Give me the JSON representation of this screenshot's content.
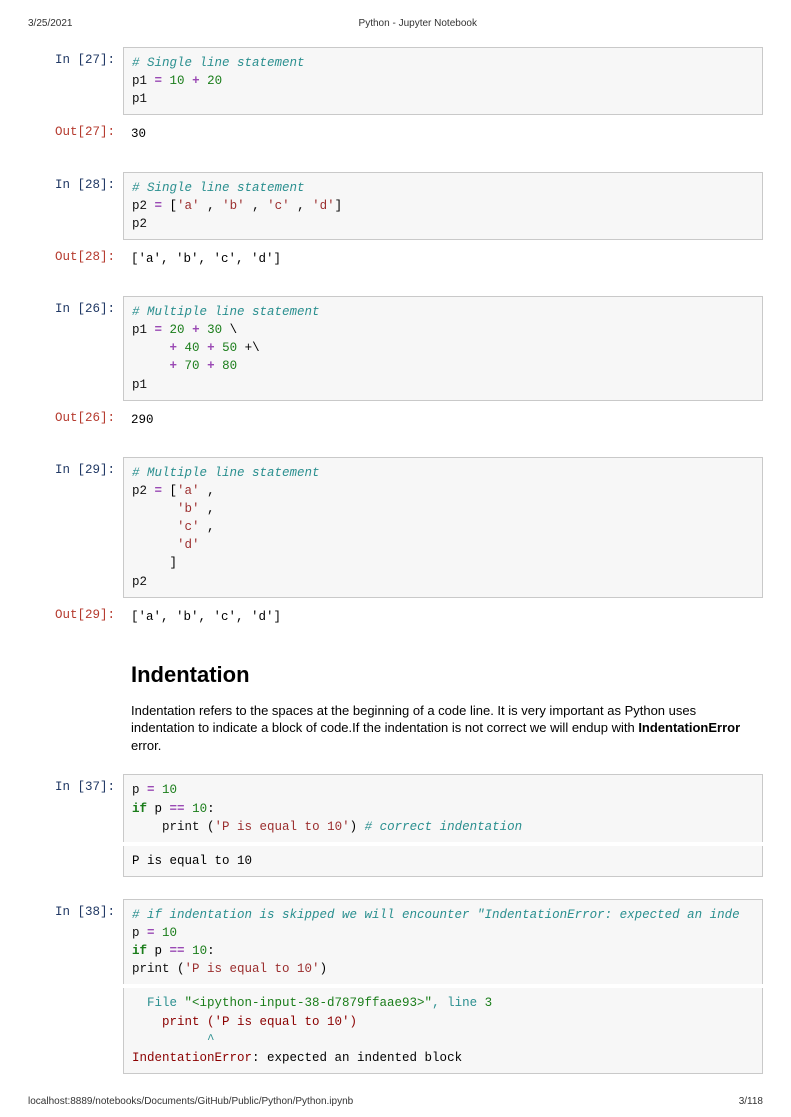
{
  "header": {
    "date": "3/25/2021",
    "title": "Python - Jupyter Notebook"
  },
  "footer": {
    "path": "localhost:8889/notebooks/Documents/GitHub/Public/Python/Python.ipynb",
    "page": "3/118"
  },
  "prompts": {
    "in27": "In [27]:",
    "out27": "Out[27]:",
    "in28": "In [28]:",
    "out28": "Out[28]:",
    "in26": "In [26]:",
    "out26": "Out[26]:",
    "in29": "In [29]:",
    "out29": "Out[29]:",
    "in37": "In [37]:",
    "in38": "In [38]:"
  },
  "code27": {
    "l1": "# Single line statement",
    "l2a": "p1 ",
    "l2op1": "=",
    "l2b": " ",
    "l2n1": "10",
    "l2c": " ",
    "l2op2": "+",
    "l2d": " ",
    "l2n2": "20",
    "l3": "p1"
  },
  "out27": "30",
  "code28": {
    "l1": "# Single line statement",
    "l2a": "p2 ",
    "l2op1": "=",
    "l2b": " [",
    "s1": "'a'",
    "c": " , ",
    "s2": "'b'",
    "s3": "'c'",
    "c2": " , ",
    "s4": "'d'",
    "l2e": "]",
    "l3": "p2"
  },
  "out28": "['a', 'b', 'c', 'd']",
  "code26": {
    "l1": "# Multiple line statement",
    "l2a": "p1 ",
    "op": "=",
    "sp": " ",
    "n20": "20",
    "plus": "+",
    "n30": "30",
    "bs": " \\",
    "l3pad": "     ",
    "n40": "40",
    "n50": "50",
    "bs2": " +\\",
    "l4pad": "     ",
    "n70": "70",
    "n80": "80",
    "l5": "p1"
  },
  "out26": "290",
  "code29": {
    "l1": "# Multiple line statement",
    "l2a": "p2 ",
    "op": "=",
    "b": " [",
    "s1": "'a'",
    "comma": " ,",
    "pad": "      ",
    "s2": "'b'",
    "s3": "'c'",
    "s4": "'d'",
    "close": "     ]",
    "l7": "p2"
  },
  "out29": "['a', 'b', 'c', 'd']",
  "md": {
    "heading": "Indentation",
    "p1a": "Indentation refers to the spaces at the beginning of a code line. It is very important as Python uses indentation to indicate a block of code.If the indentation is not correct we will endup with ",
    "p1b": "IndentationError",
    "p1c": " error."
  },
  "code37": {
    "l1a": "p ",
    "op": "=",
    "sp": " ",
    "n10": "10",
    "l2a": "if",
    "l2b": " p ",
    "eq": "==",
    "l2c": " ",
    "l2n": "10",
    "l2d": ":",
    "l3pad": "    ",
    "pr": "print",
    "l3p": " (",
    "s": "'P is equal to 10'",
    "l3e": ") ",
    "cm": "# correct indentation",
    "out": "P is equal to 10"
  },
  "code38": {
    "l1": "# if indentation is skipped we will encounter \"IndentationError: expected an inde",
    "l2a": "p ",
    "op": "=",
    "sp": " ",
    "n10": "10",
    "l3a": "if",
    "l3b": " p ",
    "eq": "==",
    "l3c": " ",
    "l3n": "10",
    "l3d": ":",
    "pr": "print",
    "l4p": " (",
    "s": "'P is equal to 10'",
    "l4e": ")",
    "err1a": "  File ",
    "err1b": "\"<ipython-input-38-d7879ffaae93>\"",
    "err1c": ", line ",
    "err1d": "3",
    "err2": "    print ('P is equal to 10')",
    "err3": "          ^",
    "err4a": "IndentationError",
    "err4b": ": expected an indented block"
  }
}
